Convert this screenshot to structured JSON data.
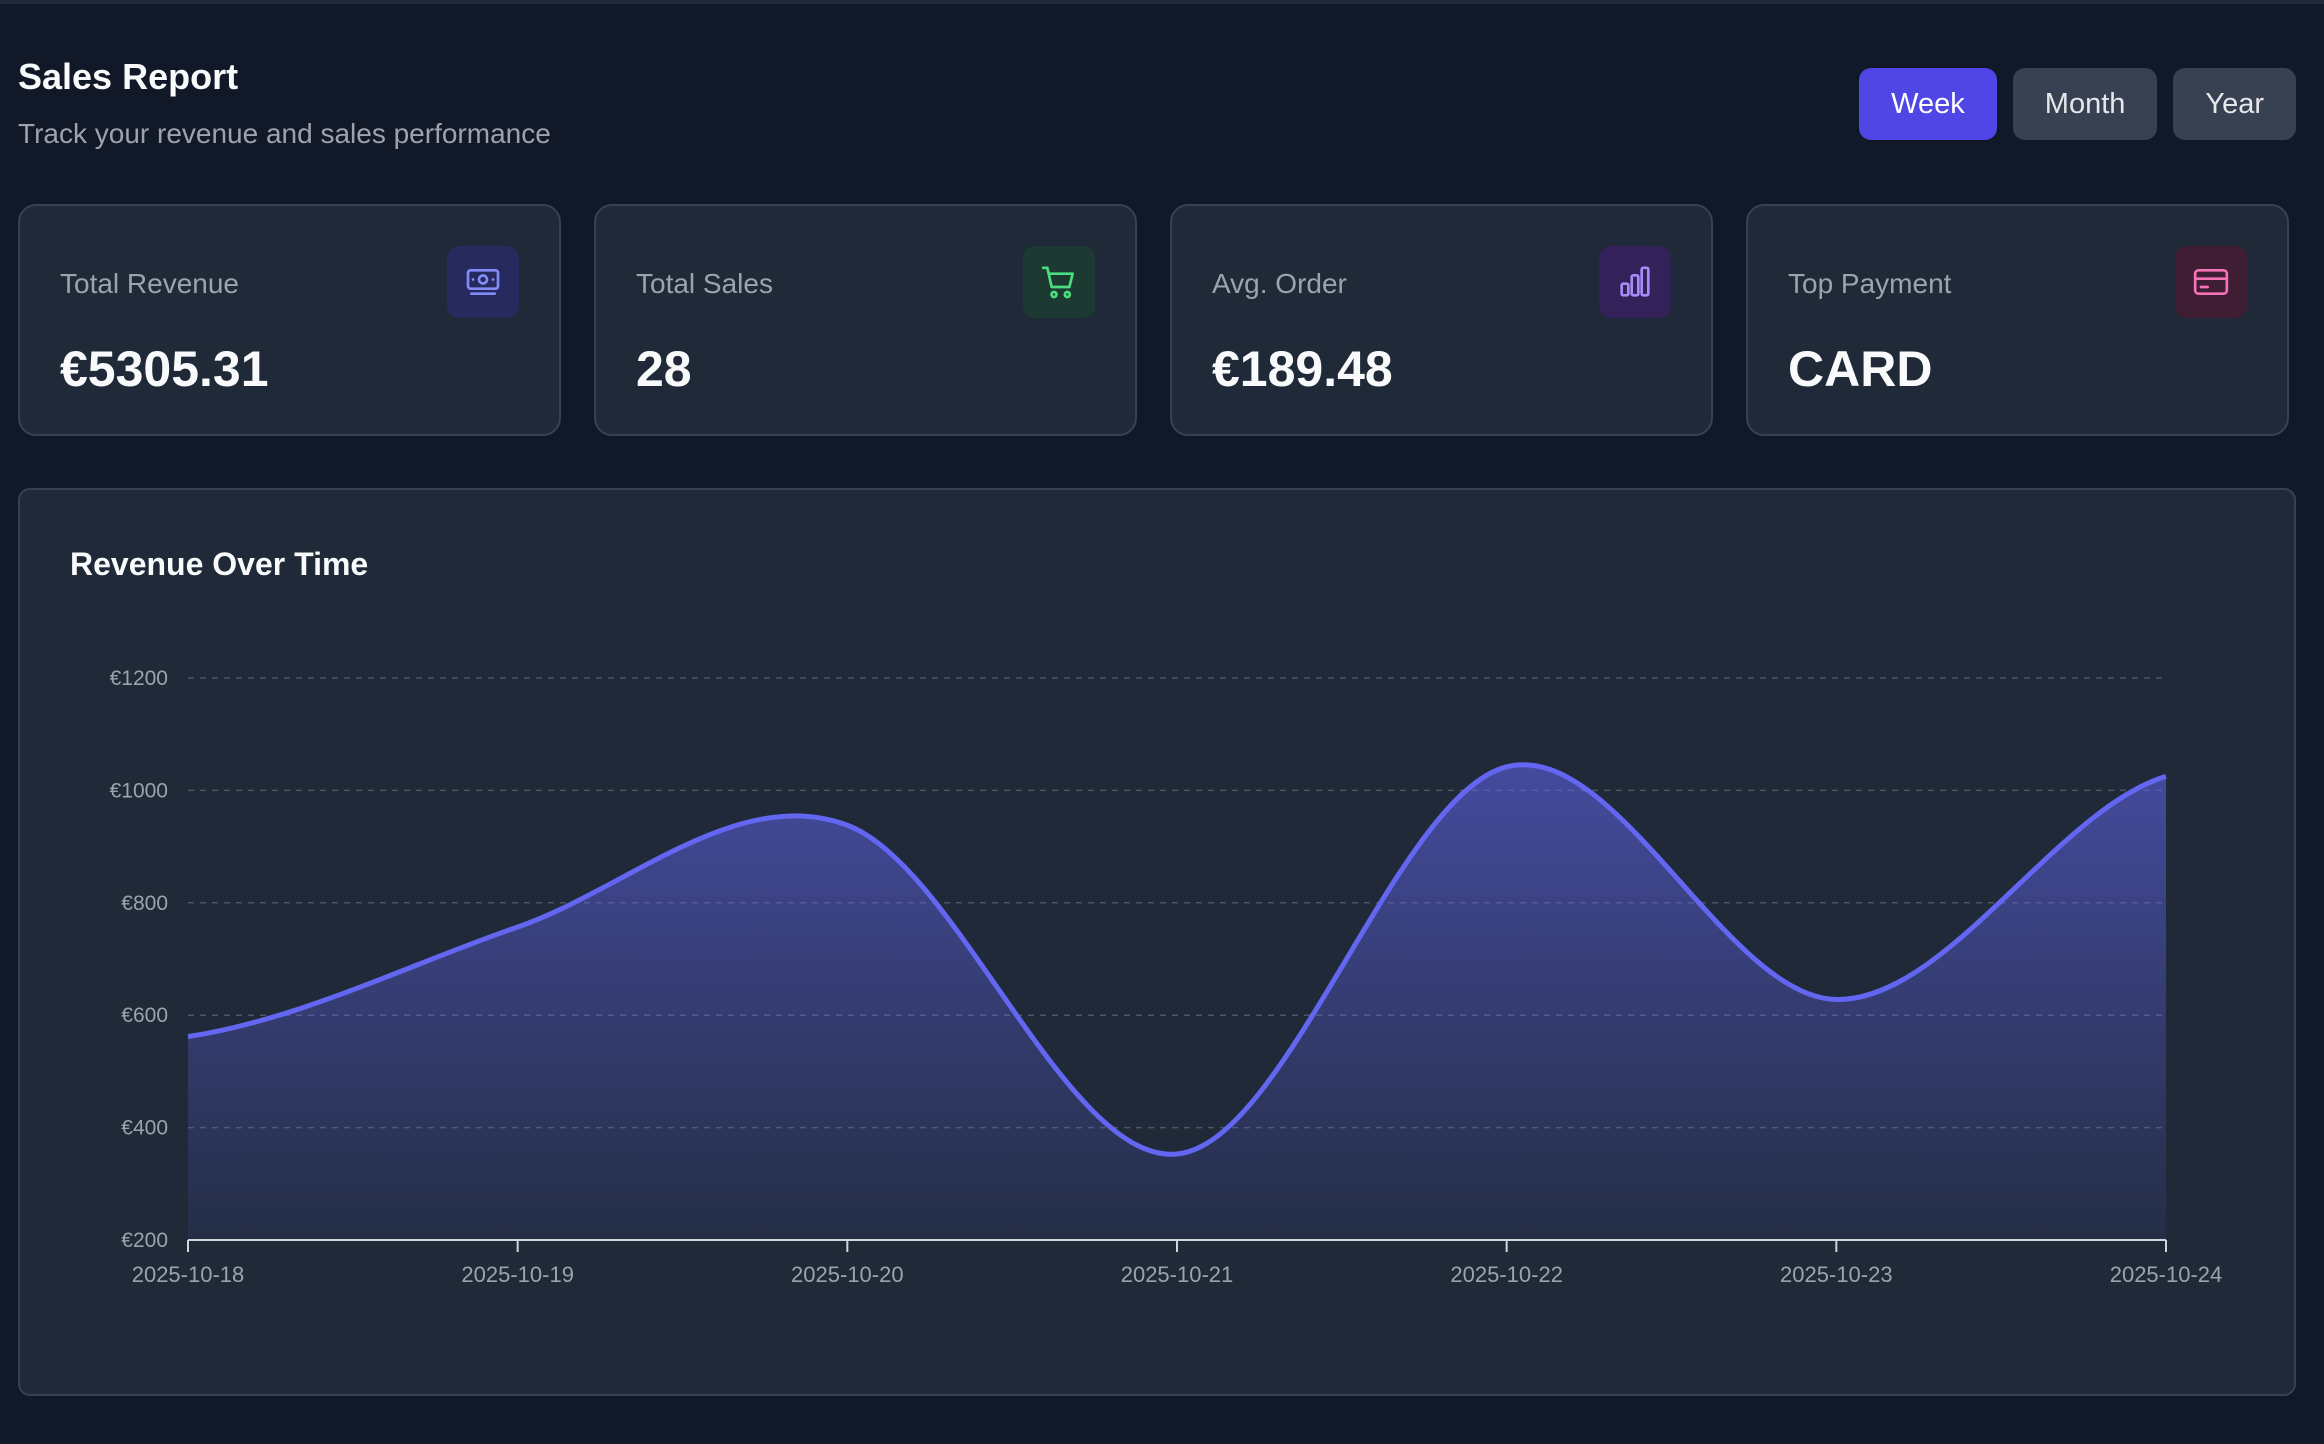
{
  "header": {
    "title": "Sales Report",
    "subtitle": "Track your revenue and sales performance"
  },
  "range_buttons": [
    {
      "label": "Week",
      "active": true
    },
    {
      "label": "Month",
      "active": false
    },
    {
      "label": "Year",
      "active": false
    }
  ],
  "stats": [
    {
      "label": "Total Revenue",
      "value": "€5305.31",
      "icon": "money-icon",
      "accent": "#818cf8",
      "icon_bg": "#312e81"
    },
    {
      "label": "Total Sales",
      "value": "28",
      "icon": "cart-icon",
      "accent": "#4ade80",
      "icon_bg": "#14532d"
    },
    {
      "label": "Avg. Order",
      "value": "€189.48",
      "icon": "bar-chart-icon",
      "accent": "#a78bfa",
      "icon_bg": "#3b0764"
    },
    {
      "label": "Top Payment",
      "value": "CARD",
      "icon": "credit-card-icon",
      "accent": "#f472b6",
      "icon_bg": "#500724"
    }
  ],
  "chart_panel": {
    "title": "Revenue Over Time"
  },
  "chart_data": {
    "type": "area",
    "title": "Revenue Over Time",
    "xlabel": "",
    "ylabel": "",
    "categories": [
      "2025-10-18",
      "2025-10-19",
      "2025-10-20",
      "2025-10-21",
      "2025-10-22",
      "2025-10-23",
      "2025-10-24"
    ],
    "values": [
      562,
      757,
      938,
      353,
      1042,
      628,
      1025
    ],
    "ylim": [
      200,
      1200
    ],
    "yticks": [
      200,
      400,
      600,
      800,
      1000,
      1200
    ],
    "ytick_labels": [
      "€200",
      "€400",
      "€600",
      "€800",
      "€1000",
      "€1200"
    ],
    "grid": true,
    "legend": "none",
    "line_color": "#6366f1",
    "fill_color": "#6366f1"
  }
}
